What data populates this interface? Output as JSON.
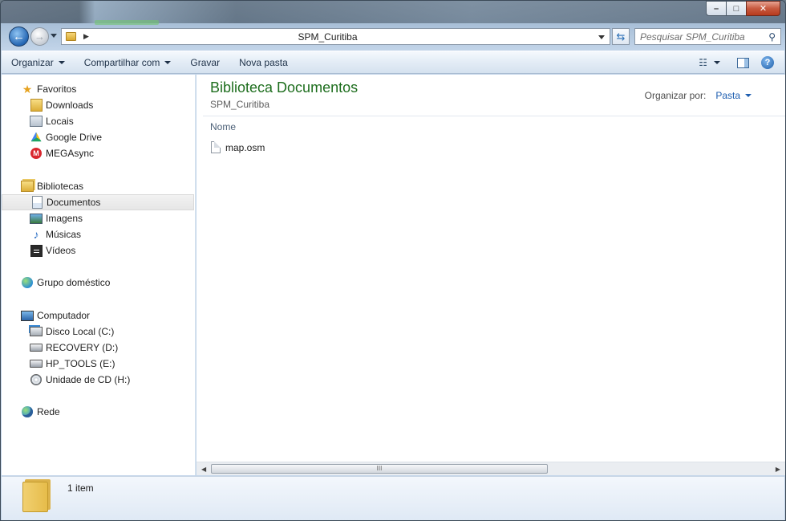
{
  "window": {
    "caption_min": "–",
    "caption_max": "□",
    "caption_close": "✕"
  },
  "address": {
    "path": "SPM_Curitiba",
    "search_placeholder": "Pesquisar SPM_Curitiba"
  },
  "toolbar": {
    "organize": "Organizar",
    "share": "Compartilhar com",
    "burn": "Gravar",
    "new_folder": "Nova pasta"
  },
  "nav": {
    "favorites": "Favoritos",
    "downloads": "Downloads",
    "locais": "Locais",
    "gdrive": "Google Drive",
    "mega": "MEGAsync",
    "libraries": "Bibliotecas",
    "documents": "Documentos",
    "images": "Imagens",
    "music": "Músicas",
    "videos": "Vídeos",
    "homegroup": "Grupo doméstico",
    "computer": "Computador",
    "disk_c": "Disco Local (C:)",
    "recovery": "RECOVERY (D:)",
    "hp_tools": "HP_TOOLS (E:)",
    "cd": "Unidade de CD (H:)",
    "network": "Rede"
  },
  "content": {
    "library_title": "Biblioteca Documentos",
    "library_subtitle": "SPM_Curitiba",
    "arrange_label": "Organizar por:",
    "arrange_value": "Pasta",
    "column_name": "Nome",
    "files": [
      {
        "name": "map.osm"
      }
    ],
    "scroll_grip": "III"
  },
  "details": {
    "count": "1 item"
  },
  "colors": {
    "library_title": "#1e6e1e",
    "link_blue": "#1e5eb0"
  }
}
